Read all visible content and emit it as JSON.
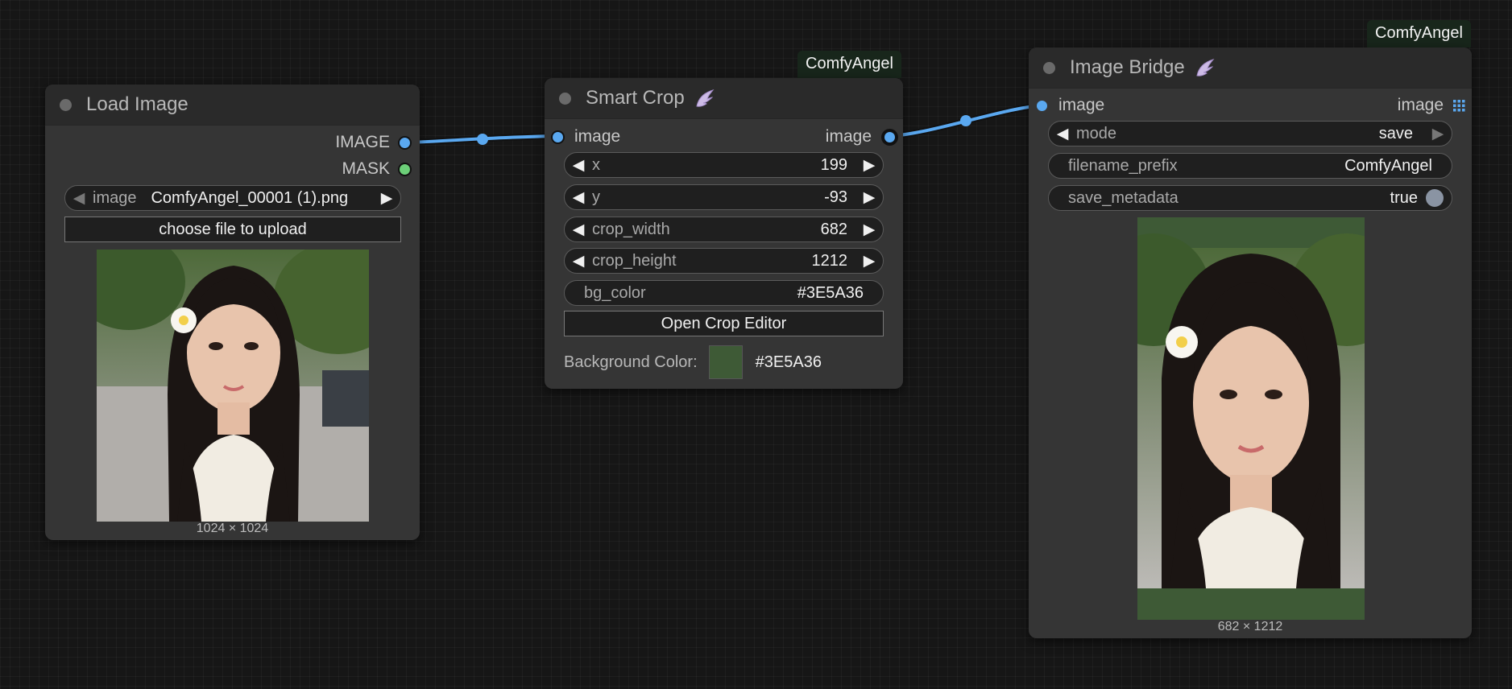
{
  "nodes": {
    "load_image": {
      "title": "Load Image",
      "outputs": [
        "IMAGE",
        "MASK"
      ],
      "image_widget": {
        "label": "image",
        "value": "ComfyAngel_00001 (1).png"
      },
      "upload_button": "choose file to upload",
      "preview_caption": "1024 × 1024"
    },
    "smart_crop": {
      "badge": "ComfyAngel",
      "title": "Smart Crop",
      "input_label": "image",
      "output_label": "image",
      "widgets": [
        {
          "label": "x",
          "value": "199"
        },
        {
          "label": "y",
          "value": "-93"
        },
        {
          "label": "crop_width",
          "value": "682"
        },
        {
          "label": "crop_height",
          "value": "1212"
        }
      ],
      "bg_color": {
        "label": "bg_color",
        "value": "#3E5A36"
      },
      "editor_button": "Open Crop Editor",
      "background_color": {
        "label": "Background Color:",
        "value": "#3E5A36",
        "swatch": "#3E5A36"
      }
    },
    "image_bridge": {
      "badge": "ComfyAngel",
      "title": "Image Bridge",
      "input_label": "image",
      "output_label": "image",
      "mode": {
        "label": "mode",
        "value": "save"
      },
      "filename_prefix": {
        "label": "filename_prefix",
        "value": "ComfyAngel"
      },
      "save_metadata": {
        "label": "save_metadata",
        "value": "true"
      },
      "preview_caption": "682 × 1212",
      "preview_bg": "#3E5A36"
    }
  },
  "colors": {
    "link": "#5aa8f0",
    "canvas": "#161616",
    "node": "#353535",
    "header": "#2a2a2a"
  },
  "icons": [
    "wing-icon",
    "grid-icon",
    "arrow-left-icon",
    "arrow-right-icon"
  ]
}
